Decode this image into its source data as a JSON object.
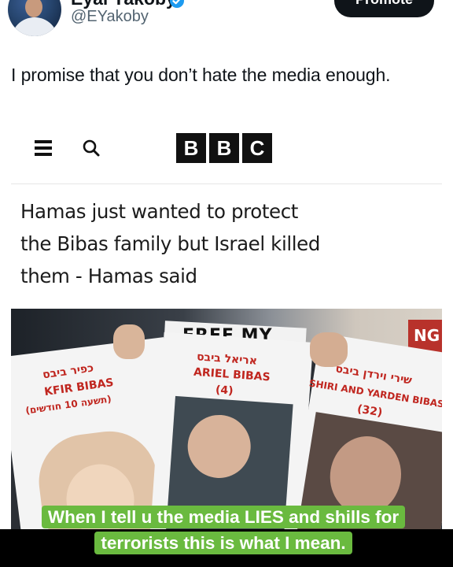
{
  "post": {
    "display_name": "Eyal Yakoby",
    "handle": "@EYakoby",
    "promote_label": "Promote",
    "text": "I promise that you don’t hate the media enough."
  },
  "embedded_article": {
    "logo_letters": [
      "B",
      "B",
      "C"
    ],
    "headline_lines": [
      "Hamas just wanted to protect",
      "the Bibas family but Israel killed",
      "them - Hamas said"
    ],
    "photo": {
      "banner_text": "FREE MY",
      "corner_text": "NG",
      "posters": [
        {
          "hebrew": "כפיר ביבס",
          "english": "KFIR BIBAS",
          "note": "(תשעה 10 חודשים)"
        },
        {
          "hebrew": "אריאל ביבס",
          "english": "ARIEL BIBAS",
          "note": "(4)"
        },
        {
          "hebrew": "שירי וירדן ביבס",
          "english": "SHIRI AND YARDEN BIBAS",
          "note": "(32)"
        }
      ]
    }
  },
  "caption": "When I tell u the media LIES and shills for terrorists this is what I mean.",
  "colors": {
    "caption_highlight": "#6aba3f",
    "verified_badge": "#1d9bf0",
    "poster_red": "#c0261f"
  },
  "icons": [
    "verified-badge-icon",
    "menu-icon",
    "search-icon"
  ]
}
